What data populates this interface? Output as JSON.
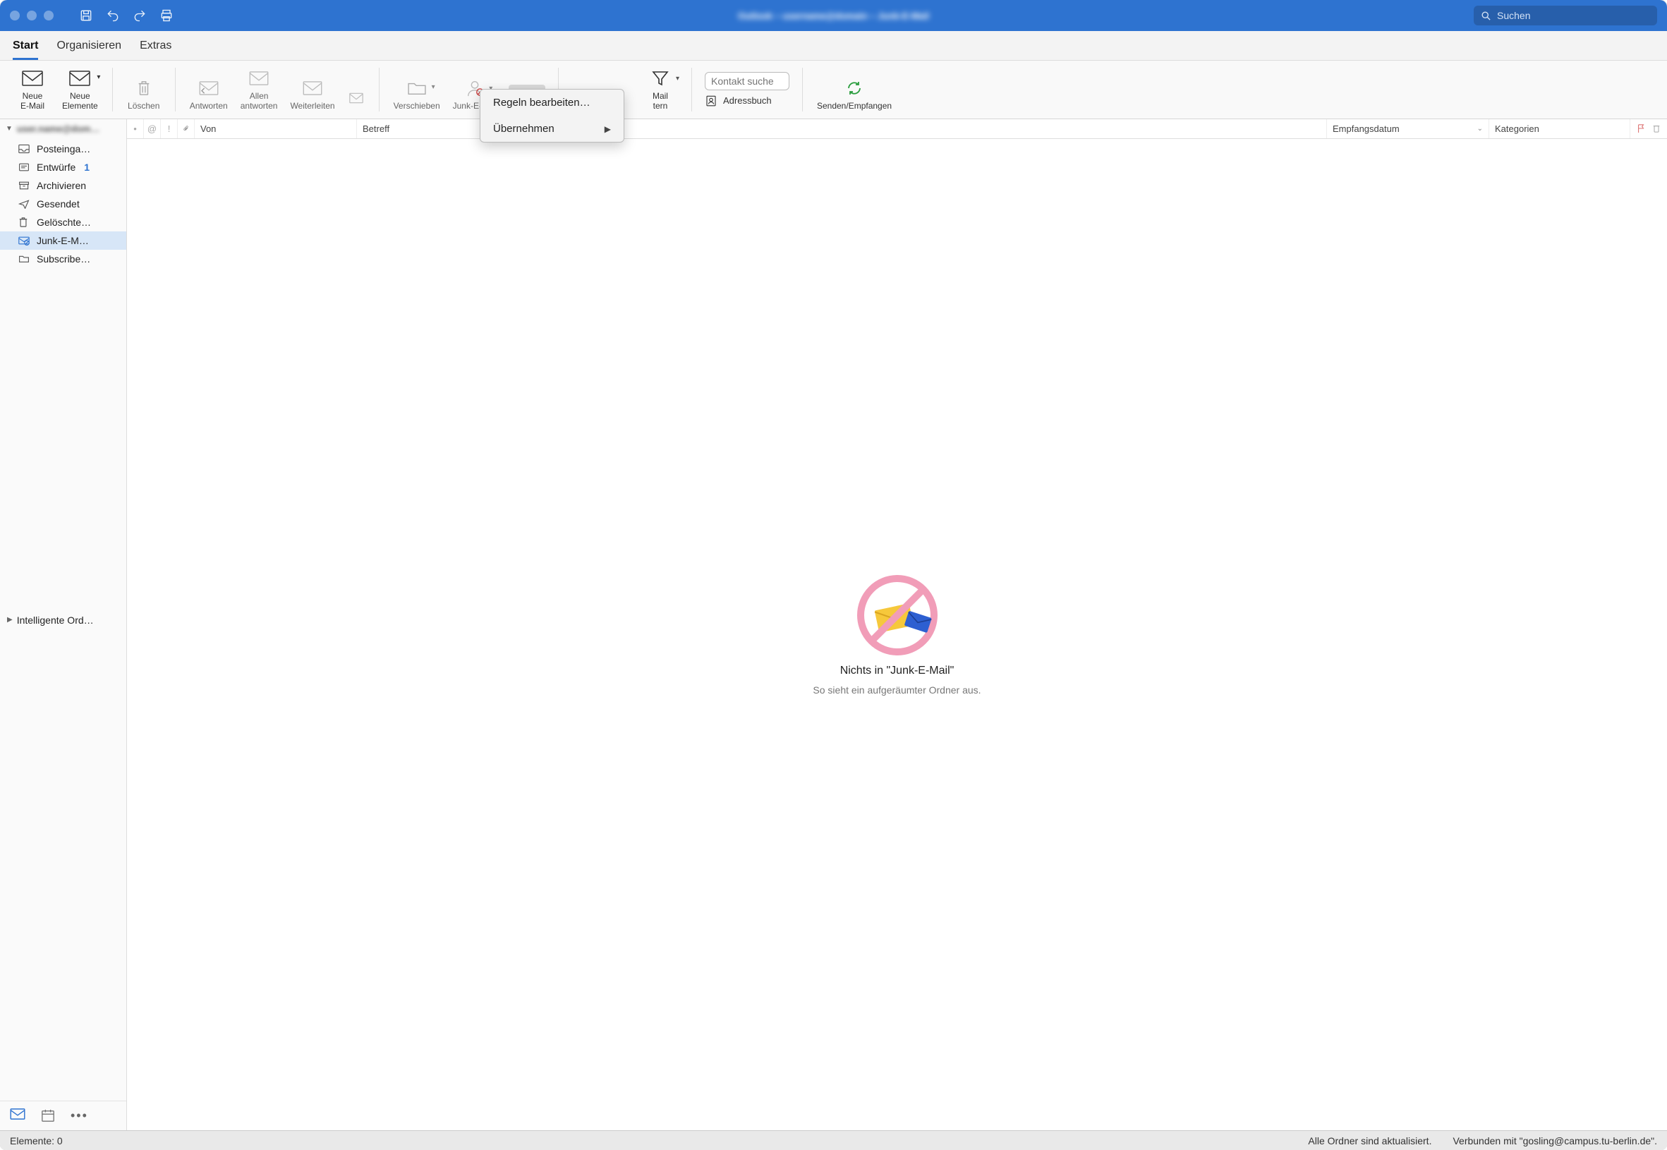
{
  "titlebar": {
    "app_title": "Outlook – username@domain  – Junk-E-Mail",
    "search_placeholder": "Suchen"
  },
  "tabs": {
    "start": "Start",
    "organisieren": "Organisieren",
    "extras": "Extras"
  },
  "ribbon": {
    "neue_email": "Neue\nE-Mail",
    "neue_elemente": "Neue\nElemente",
    "loeschen": "Löschen",
    "antworten": "Antworten",
    "allen_antworten": "Allen\nantworten",
    "weiterleiten": "Weiterleiten",
    "verschieben": "Verschieben",
    "junk": "Junk-E-Mail",
    "kontakt_placeholder": "Kontakt suche",
    "adressbuch": "Adressbuch",
    "senden_empfangen": "Senden/Empfangen",
    "mail_filtern_1": "Mail",
    "mail_filtern_2": "tern"
  },
  "dropdown": {
    "regeln": "Regeln bearbeiten…",
    "uebernehmen": "Übernehmen"
  },
  "sidebar": {
    "account": "user.name@dom…",
    "posteingang": "Posteinga…",
    "entwuerfe": "Entwürfe",
    "entwuerfe_count": "1",
    "archivieren": "Archivieren",
    "gesendet": "Gesendet",
    "geloeschte": "Gelöschte…",
    "junk": "Junk-E-M…",
    "subscribed": "Subscribe…",
    "smart": "Intelligente Ord…"
  },
  "columns": {
    "von": "Von",
    "betreff": "Betreff",
    "empfang": "Empfangsdatum",
    "kategorien": "Kategorien"
  },
  "empty": {
    "title": "Nichts in \"Junk-E-Mail\"",
    "subtitle": "So sieht ein aufgeräumter Ordner aus."
  },
  "statusbar": {
    "elemente": "Elemente: 0",
    "aktualisiert": "Alle Ordner sind aktualisiert.",
    "verbunden": "Verbunden mit \"gosling@campus.tu-berlin.de\"."
  }
}
